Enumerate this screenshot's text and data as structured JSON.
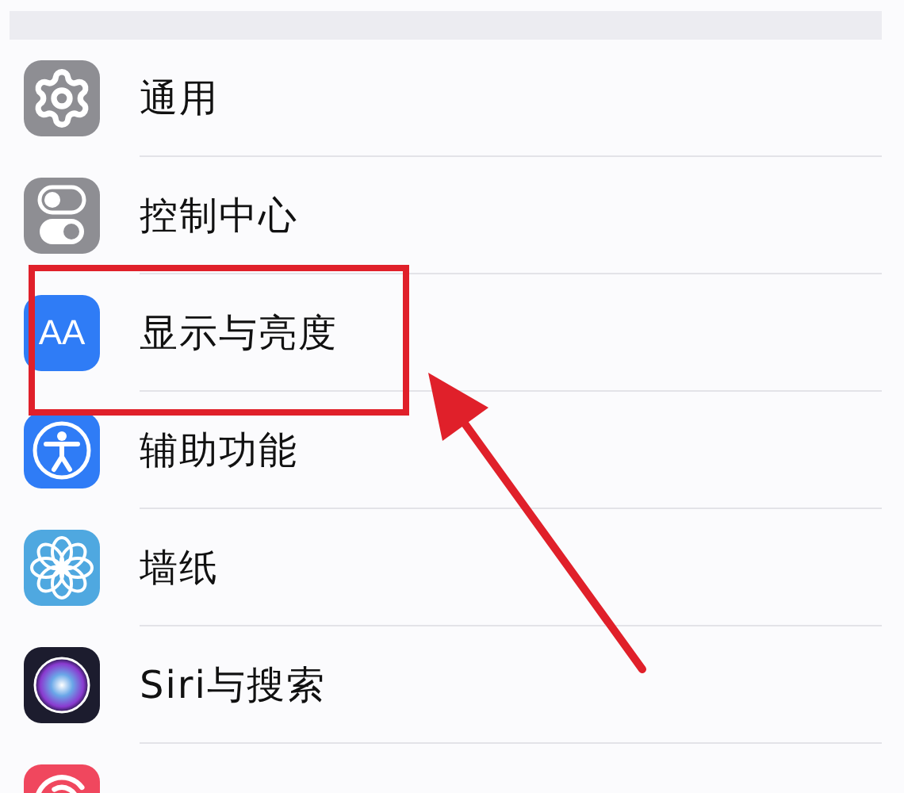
{
  "items": [
    {
      "label": "通用",
      "kind": "gear",
      "highlighted": false
    },
    {
      "label": "控制中心",
      "kind": "toggles",
      "highlighted": false
    },
    {
      "label": "显示与亮度",
      "kind": "text",
      "icon_text": "AA",
      "highlighted": true
    },
    {
      "label": "辅助功能",
      "kind": "accessibility",
      "highlighted": false
    },
    {
      "label": "墙纸",
      "kind": "flower",
      "highlighted": false
    },
    {
      "label": "Siri与搜索",
      "kind": "orb",
      "highlighted": false
    },
    {
      "kind": "fingerprint",
      "highlighted": false
    }
  ]
}
